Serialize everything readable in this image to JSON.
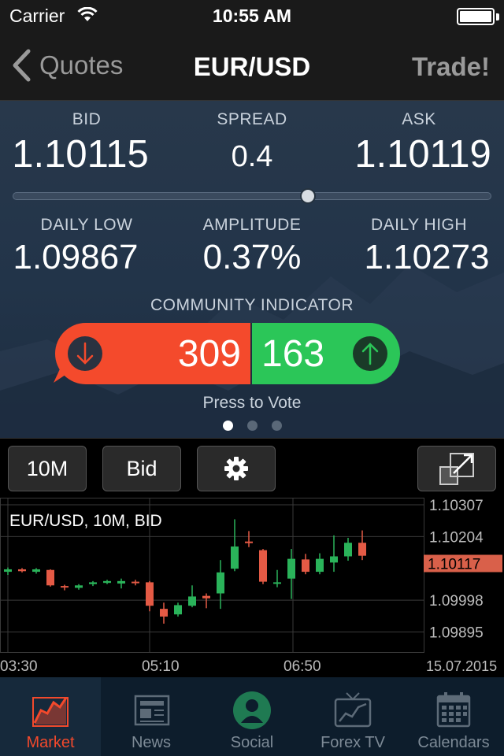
{
  "status": {
    "carrier": "Carrier",
    "time": "10:55 AM"
  },
  "nav": {
    "back_label": "Quotes",
    "title": "EUR/USD",
    "trade_label": "Trade!"
  },
  "quote": {
    "bid_label": "BID",
    "bid": "1.10115",
    "spread_label": "SPREAD",
    "spread": "0.4",
    "ask_label": "ASK",
    "ask": "1.10119",
    "daily_low_label": "DAILY LOW",
    "daily_low": "1.09867",
    "amplitude_label": "AMPLITUDE",
    "amplitude": "0.37%",
    "daily_high_label": "DAILY HIGH",
    "daily_high": "1.10273",
    "range_position": 0.616
  },
  "community": {
    "title": "COMMUNITY INDICATOR",
    "sell_votes": "309",
    "buy_votes": "163",
    "press_label": "Press to Vote",
    "page_count": 3,
    "active_page": 0
  },
  "toolbar": {
    "timeframe_label": "10M",
    "price_type_label": "Bid",
    "settings_icon": "gear-icon",
    "expand_icon": "expand-icon"
  },
  "chart": {
    "legend": "EUR/USD, 10M, BID",
    "current_price_label": "1.10117",
    "date_label": "15.07.2015",
    "colors": {
      "up": "#2ab35a",
      "down": "#e45a45",
      "grid": "#3a3a3a",
      "axis_text": "#bbbbbb",
      "price_tag": "#d9604a"
    }
  },
  "chart_data": {
    "type": "candlestick",
    "title": "EUR/USD, 10M, BID",
    "x_tick_labels": [
      "03:30",
      "05:10",
      "06:50"
    ],
    "y_tick_labels": [
      "1.10307",
      "1.10204",
      "1.09998",
      "1.09895"
    ],
    "ylim": [
      1.0983,
      1.1033
    ],
    "current_price": 1.10117,
    "candles": [
      {
        "open": 1.1009,
        "close": 1.10098,
        "high": 1.10104,
        "low": 1.1008
      },
      {
        "open": 1.10098,
        "close": 1.10092,
        "high": 1.10102,
        "low": 1.10088
      },
      {
        "open": 1.1009,
        "close": 1.10098,
        "high": 1.10102,
        "low": 1.10084
      },
      {
        "open": 1.10096,
        "close": 1.10046,
        "high": 1.10098,
        "low": 1.10042
      },
      {
        "open": 1.10044,
        "close": 1.1004,
        "high": 1.10048,
        "low": 1.1003
      },
      {
        "open": 1.10038,
        "close": 1.10046,
        "high": 1.1005,
        "low": 1.10032
      },
      {
        "open": 1.1005,
        "close": 1.10056,
        "high": 1.1006,
        "low": 1.10044
      },
      {
        "open": 1.10054,
        "close": 1.1006,
        "high": 1.10064,
        "low": 1.1005
      },
      {
        "open": 1.10052,
        "close": 1.1006,
        "high": 1.10068,
        "low": 1.10036
      },
      {
        "open": 1.10058,
        "close": 1.10054,
        "high": 1.10064,
        "low": 1.10046
      },
      {
        "open": 1.10056,
        "close": 1.0998,
        "high": 1.1006,
        "low": 1.09962
      },
      {
        "open": 1.0997,
        "close": 1.09945,
        "high": 1.0999,
        "low": 1.09922
      },
      {
        "open": 1.09952,
        "close": 1.09982,
        "high": 1.0999,
        "low": 1.09945
      },
      {
        "open": 1.0998,
        "close": 1.1001,
        "high": 1.10046,
        "low": 1.09975
      },
      {
        "open": 1.10012,
        "close": 1.10004,
        "high": 1.1002,
        "low": 1.09972
      },
      {
        "open": 1.1002,
        "close": 1.10088,
        "high": 1.10128,
        "low": 1.0997
      },
      {
        "open": 1.101,
        "close": 1.10172,
        "high": 1.1026,
        "low": 1.10092
      },
      {
        "open": 1.10188,
        "close": 1.10184,
        "high": 1.10222,
        "low": 1.1017
      },
      {
        "open": 1.1016,
        "close": 1.10058,
        "high": 1.10164,
        "low": 1.1005
      },
      {
        "open": 1.10054,
        "close": 1.10056,
        "high": 1.10096,
        "low": 1.1004
      },
      {
        "open": 1.10068,
        "close": 1.10132,
        "high": 1.10164,
        "low": 1.10002
      },
      {
        "open": 1.1013,
        "close": 1.1009,
        "high": 1.10148,
        "low": 1.10082
      },
      {
        "open": 1.1009,
        "close": 1.10132,
        "high": 1.1015,
        "low": 1.10082
      },
      {
        "open": 1.1012,
        "close": 1.1014,
        "high": 1.10208,
        "low": 1.1009
      },
      {
        "open": 1.1014,
        "close": 1.10184,
        "high": 1.102,
        "low": 1.10126
      },
      {
        "open": 1.10184,
        "close": 1.10142,
        "high": 1.10224,
        "low": 1.10128
      }
    ]
  },
  "tabs": [
    {
      "label": "Market",
      "icon": "market-chart-icon",
      "active": true
    },
    {
      "label": "News",
      "icon": "newspaper-icon",
      "active": false
    },
    {
      "label": "Social",
      "icon": "person-icon",
      "active": false
    },
    {
      "label": "Forex TV",
      "icon": "tv-icon",
      "active": false
    },
    {
      "label": "Calendars",
      "icon": "calendar-icon",
      "active": false
    }
  ]
}
